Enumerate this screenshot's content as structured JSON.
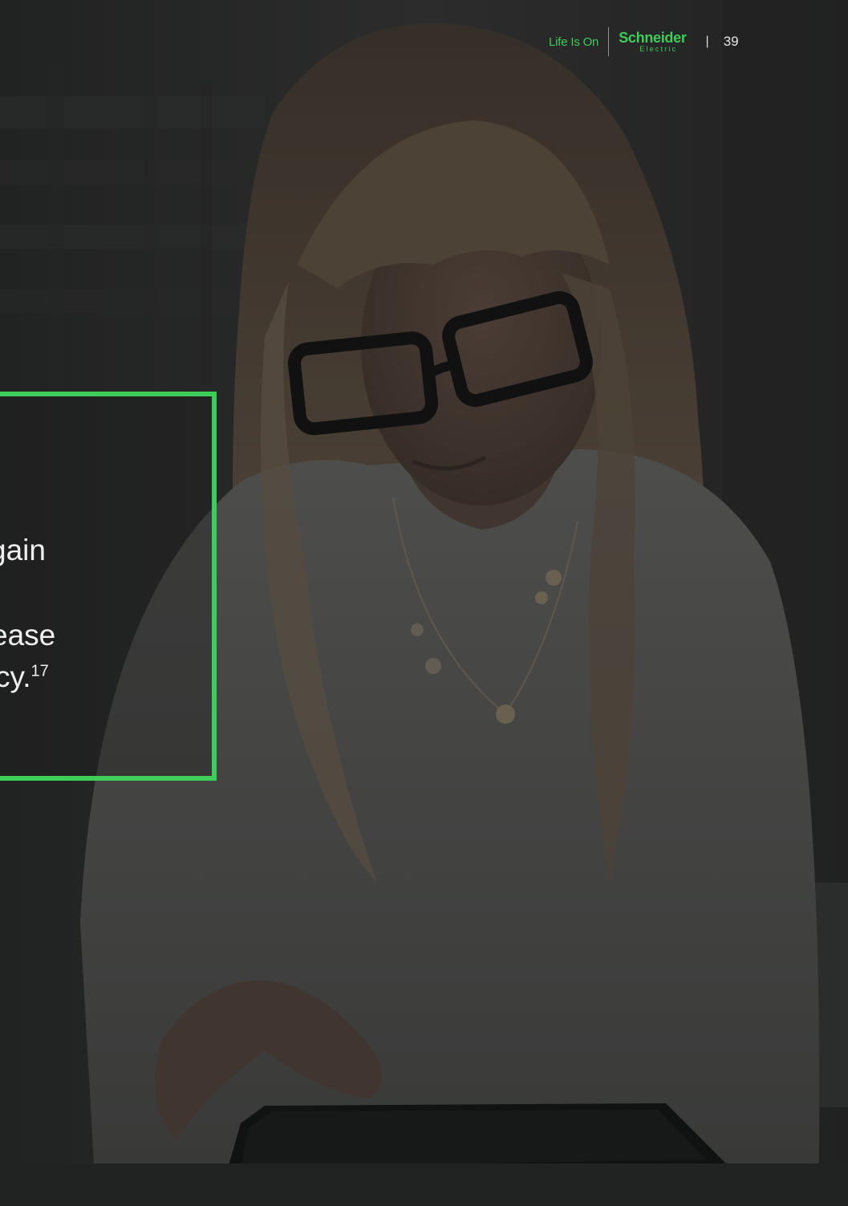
{
  "header": {
    "tagline": "Life Is On",
    "brand_top": "Schneider",
    "brand_bottom": "Electric",
    "page_number": "39"
  },
  "callout": {
    "line1": "gain",
    "line2": "ease",
    "line3": "cy.",
    "footnote": "17"
  },
  "colors": {
    "accent": "#3dcd58",
    "background": "#1e1f1f"
  }
}
